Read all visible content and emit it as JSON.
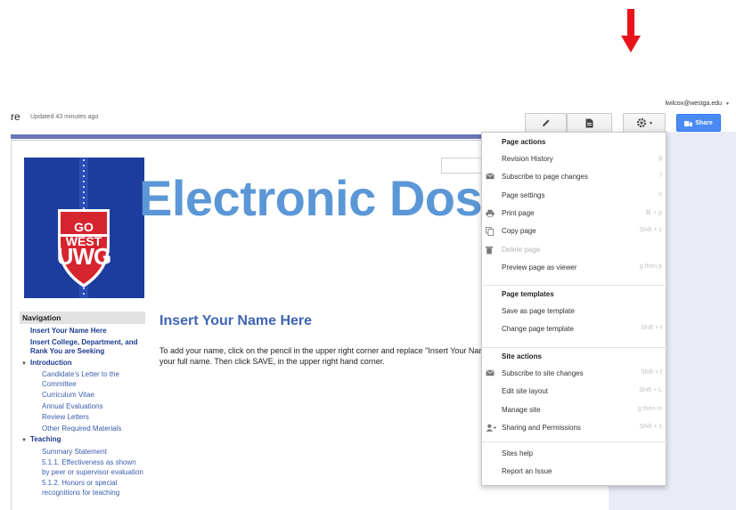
{
  "header": {
    "user_email": "lwilcox@westga.edu",
    "page_title_fragment": "re",
    "updated_text": "Updated 43 minutes ago",
    "share_label": "Share"
  },
  "banner": {
    "title": "Electronic Dossier",
    "logo_top": "GO WEST",
    "logo_bottom": "UWG",
    "logo_colors": {
      "background": "#1c3d9e",
      "red": "#d6252f",
      "white": "#ffffff"
    }
  },
  "navigation": {
    "header": "Navigation",
    "items": [
      {
        "label": "Insert Your Name Here",
        "level": 0,
        "collapsible": false
      },
      {
        "label": "Insert College, Department, and Rank You are Seeking",
        "level": 0,
        "collapsible": false
      },
      {
        "label": "Introduction",
        "level": 0,
        "collapsible": true
      },
      {
        "label": "Candidate's Letter to the Committee",
        "level": 1
      },
      {
        "label": "Curriculum Vitae",
        "level": 1
      },
      {
        "label": "Annual Evaluations",
        "level": 1
      },
      {
        "label": "Review Letters",
        "level": 1
      },
      {
        "label": "Other Required Materials",
        "level": 1
      },
      {
        "label": "Teaching",
        "level": 0,
        "collapsible": true
      },
      {
        "label": "Summary Statement",
        "level": 1
      },
      {
        "label": "5.1.1. Effectiveness as shown by peer or supervisor evaluation",
        "level": 1
      },
      {
        "label": "5.1.2. Honors or special recognitions for teaching",
        "level": 1
      }
    ]
  },
  "content": {
    "title": "Insert Your Name Here",
    "line1": "To add your name, click on the pencil in the upper right corner and replace \"Insert Your Name Here\" with",
    "line2": "your full name. Then click SAVE, in the upper right hand corner."
  },
  "menu": {
    "sections": [
      {
        "heading": "Page actions",
        "items": [
          {
            "label": "Revision History",
            "shortcut": "g",
            "icon": "",
            "disabled": false
          },
          {
            "label": "Subscribe to page changes",
            "shortcut": "f",
            "icon": "mail-icon",
            "disabled": false
          },
          {
            "label": "Page settings",
            "shortcut": "u",
            "icon": "",
            "disabled": false
          },
          {
            "label": "Print page",
            "shortcut": "⌘ + p",
            "icon": "print-icon",
            "disabled": false
          },
          {
            "label": "Copy page",
            "shortcut": "Shift + c",
            "icon": "copy-icon",
            "disabled": false
          },
          {
            "label": "Delete page",
            "shortcut": "",
            "icon": "trash-icon",
            "disabled": true
          },
          {
            "label": "Preview page as viewer",
            "shortcut": "g then p",
            "icon": "",
            "disabled": false
          }
        ]
      },
      {
        "heading": "Page templates",
        "items": [
          {
            "label": "Save as page template",
            "shortcut": "",
            "icon": "",
            "disabled": false
          },
          {
            "label": "Change page template",
            "shortcut": "Shift + t",
            "icon": "",
            "disabled": false
          }
        ]
      },
      {
        "heading": "Site actions",
        "items": [
          {
            "label": "Subscribe to site changes",
            "shortcut": "Shift + f",
            "icon": "mail-icon",
            "disabled": false
          },
          {
            "label": "Edit site layout",
            "shortcut": "Shift + L",
            "icon": "",
            "disabled": false
          },
          {
            "label": "Manage site",
            "shortcut": "g then m",
            "icon": "",
            "disabled": false
          },
          {
            "label": "Sharing and Permissions",
            "shortcut": "Shift + s",
            "icon": "add-person-icon",
            "disabled": false
          }
        ]
      },
      {
        "heading": "",
        "items": [
          {
            "label": "Sites help",
            "shortcut": "",
            "icon": "",
            "disabled": false
          },
          {
            "label": "Report an Issue",
            "shortcut": "",
            "icon": "",
            "disabled": false
          }
        ]
      }
    ]
  },
  "colors": {
    "accent_blue": "#4a8af4",
    "site_bar": "#6a76b4",
    "title_blue": "#5b97d6",
    "annotation_red": "#e8141b"
  }
}
